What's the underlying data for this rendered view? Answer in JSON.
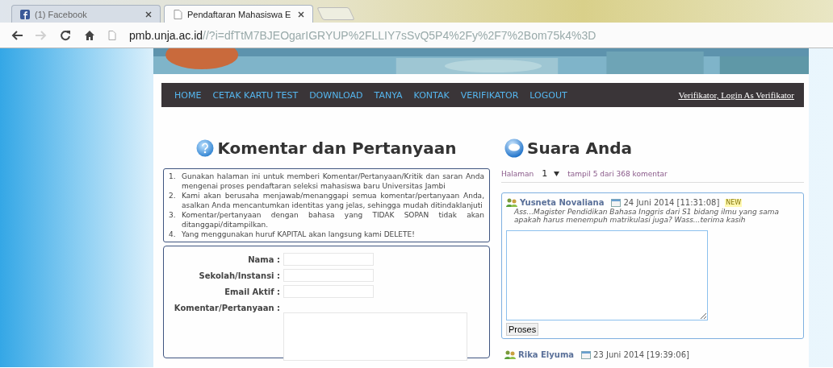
{
  "browser": {
    "tabs": [
      {
        "title": "(1) Facebook",
        "kind": "facebook",
        "selected": false
      },
      {
        "title": "Pendaftaran Mahasiswa E",
        "kind": "page",
        "selected": true
      }
    ],
    "buttons": [
      {
        "kind": "back",
        "disabled": false
      },
      {
        "kind": "forward",
        "disabled": true
      },
      {
        "kind": "reload",
        "disabled": false
      },
      {
        "kind": "home",
        "disabled": false
      }
    ],
    "url": {
      "host": "pmb.unja.ac.id",
      "path": "//?i=dfTtM7BJEOgarIGRYUP%2FLLIY7sSvQ5P4%2Fy%2F7%2Bom75k4%3D"
    }
  },
  "nav": {
    "items": [
      "HOME",
      "CETAK KARTU TEST",
      "DOWNLOAD",
      "TANYA",
      "KONTAK",
      "VERIFIKATOR",
      "LOGOUT"
    ],
    "user": "Verifikator, Login As Verifikator"
  },
  "left": {
    "title": "Komentar dan Pertanyaan",
    "rules": [
      {
        "marker": "1.",
        "text": "Gunakan halaman ini untuk memberi Komentar/Pertanyaan/Kritik dan saran Anda mengenai proses pendaftaran seleksi mahasiswa baru Universitas Jambi"
      },
      {
        "marker": "2.",
        "text": "Kami akan berusaha menjawab/menanggapi semua komentar/pertanyaan Anda, asalkan Anda mencantumkan identitas yang jelas, sehingga mudah ditindaklanjuti"
      },
      {
        "marker": "3.",
        "text": "Komentar/pertanyaan dengan bahasa yang TIDAK SOPAN tidak akan ditanggapi/ditampilkan."
      },
      {
        "marker": "4.",
        "text": "Yang menggunakan huruf KAPITAL akan langsung kami DELETE!"
      }
    ],
    "fields": [
      {
        "label": "Nama :",
        "kind": "text"
      },
      {
        "label": "Sekolah/Instansi :",
        "kind": "text"
      },
      {
        "label": "Email Aktif :",
        "kind": "text"
      },
      {
        "label": "Komentar/Pertanyaan :",
        "kind": "textarea"
      }
    ]
  },
  "right": {
    "title": "Suara Anda",
    "pager": {
      "label": "Halaman",
      "page": "1",
      "summary": "tampil 5 dari 368 komentar"
    },
    "comments": [
      {
        "author": "Yusneta Novaliana",
        "date": "24 Juni 2014 [11:31:08]",
        "badge": "NEW",
        "message": "Ass...Magister Pendidikan Bahasa Inggris dari S1 bidang ilmu yang sama apakah harus menempuh matrikulasi juga? Wass...terima kasih",
        "reply_button": "Proses"
      },
      {
        "author": "Rika Elyuma",
        "date": "23 Juni 2014 [19:39:06]"
      }
    ]
  }
}
